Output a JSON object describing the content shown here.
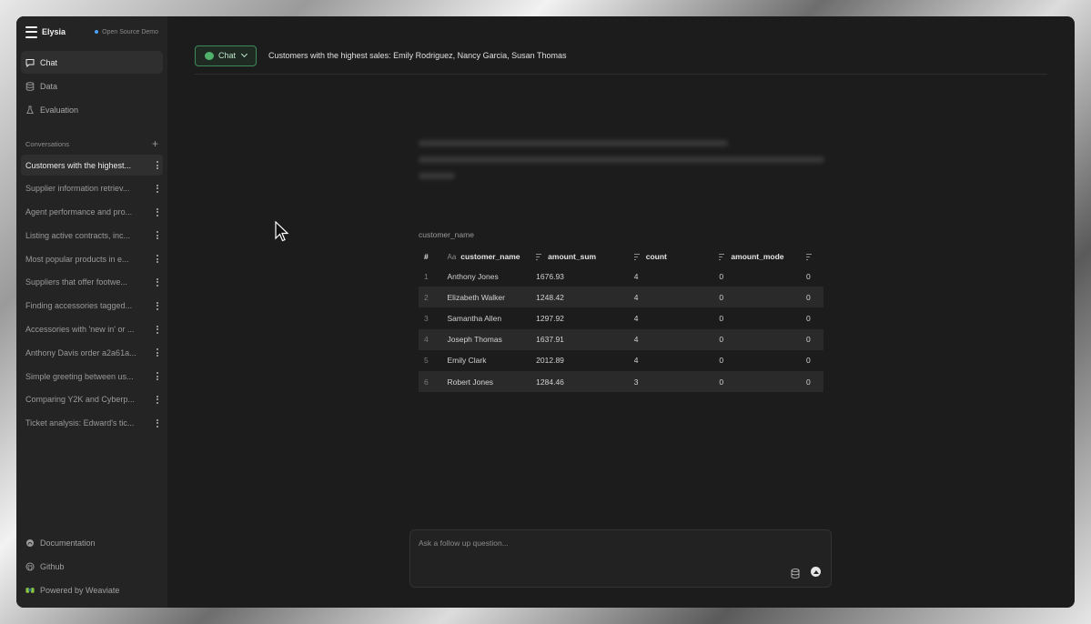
{
  "brand": {
    "name": "Elysia",
    "badge": "Open Source Demo"
  },
  "nav": [
    {
      "label": "Chat",
      "icon": "chat-icon"
    },
    {
      "label": "Data",
      "icon": "database-icon"
    },
    {
      "label": "Evaluation",
      "icon": "flask-icon"
    }
  ],
  "conversations": {
    "title": "Conversations",
    "items": [
      "Customers with the highest...",
      "Supplier information retriev...",
      "Agent performance and pro...",
      "Listing active contracts, inc...",
      "Most popular products in e...",
      "Suppliers that offer footwe...",
      "Finding accessories tagged...",
      "Accessories with 'new in' or ...",
      "Anthony Davis order a2a61a...",
      "Simple greeting between us...",
      "Comparing Y2K and Cyberp...",
      "Ticket analysis: Edward's tic..."
    ]
  },
  "footer": [
    {
      "label": "Documentation",
      "icon": "docs-icon"
    },
    {
      "label": "Github",
      "icon": "github-icon"
    },
    {
      "label": "Powered by Weaviate",
      "icon": "weaviate-icon"
    }
  ],
  "header": {
    "mode_label": "Chat",
    "conversation_title": "Customers with the highest sales: Emily Rodriguez, Nancy Garcia, Susan Thomas"
  },
  "table": {
    "caption": "customer_name",
    "columns": [
      "#",
      "customer_name",
      "amount_sum",
      "count",
      "amount_mode"
    ],
    "rows": [
      [
        "1",
        "Anthony Jones",
        "1676.93",
        "4",
        "0",
        "0"
      ],
      [
        "2",
        "Elizabeth Walker",
        "1248.42",
        "4",
        "0",
        "0"
      ],
      [
        "3",
        "Samantha Allen",
        "1297.92",
        "4",
        "0",
        "0"
      ],
      [
        "4",
        "Joseph Thomas",
        "1637.91",
        "4",
        "0",
        "0"
      ],
      [
        "5",
        "Emily Clark",
        "2012.89",
        "4",
        "0",
        "0"
      ],
      [
        "6",
        "Robert Jones",
        "1284.46",
        "3",
        "0",
        "0"
      ]
    ]
  },
  "input": {
    "placeholder": "Ask a follow up question..."
  }
}
